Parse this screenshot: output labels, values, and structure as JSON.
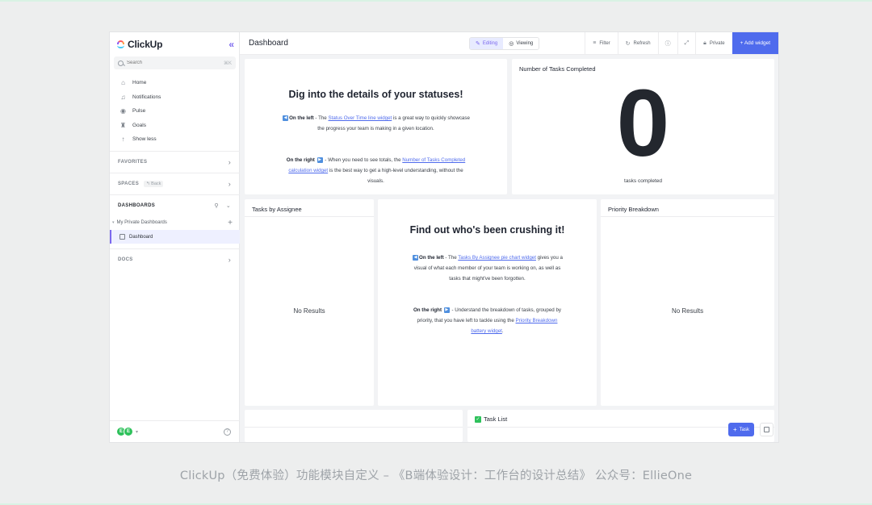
{
  "app": {
    "brand": "ClickUp",
    "search": {
      "placeholder": "Search",
      "shortcut": "⌘K"
    },
    "nav": [
      {
        "label": "Home",
        "icon": "home-icon"
      },
      {
        "label": "Notifications",
        "icon": "bell-icon"
      },
      {
        "label": "Pulse",
        "icon": "pulse-icon"
      },
      {
        "label": "Goals",
        "icon": "trophy-icon"
      },
      {
        "label": "Show less",
        "icon": "arrow-up-icon"
      }
    ],
    "sections": {
      "favorites": "FAVORITES",
      "spaces": "SPACES",
      "spaces_back": "Back",
      "dashboards": "DASHBOARDS",
      "docs": "DOCS"
    },
    "dashboards_group": "My Private Dashboards",
    "dashboard_item": "Dashboard",
    "avatars": [
      "E",
      "E"
    ]
  },
  "header": {
    "title": "Dashboard",
    "mode_editing": "Editing",
    "mode_viewing": "Viewing",
    "filter": "Filter",
    "refresh": "Refresh",
    "private": "Private",
    "add_widget": "+ Add widget"
  },
  "widgets": {
    "statuses": {
      "heading": "Dig into the details of your statuses!",
      "left_label": "On the left",
      "left_pre": " - The ",
      "left_link": "Status Over Time line widget",
      "left_post_1": " is a great way to quickly showcase",
      "left_post_2": "the progress your team is making in a given location.",
      "right_label": "On the right",
      "right_pre": " - When you need to see totals, the ",
      "right_link_1": "Number of Tasks Completed",
      "right_link_2": "calculation widget",
      "right_post_1": " is the best way to get a high-level understanding, without the",
      "right_post_2": "visuals."
    },
    "tasks_completed": {
      "title": "Number of Tasks Completed",
      "value": "0",
      "caption": "tasks completed"
    },
    "tasks_by_assignee": {
      "title": "Tasks by Assignee",
      "empty": "No Results"
    },
    "crushing": {
      "heading": "Find out who's been crushing it!",
      "left_label": "On the left",
      "left_pre": " - The ",
      "left_link": "Tasks By Assignee pie chart widget",
      "left_post_1": " gives you a",
      "left_post_2": "visual of what each member of your team is working on, as well as",
      "left_post_3": "tasks that might've been forgotten.",
      "right_label": "On the right",
      "right_pre_1": " - Understand the breakdown of tasks, grouped by",
      "right_pre_2": "priority, that you have left to tackle using the ",
      "right_link_1": "Priority Breakdown",
      "right_link_2": "battery widget",
      "right_post": "."
    },
    "priority_breakdown": {
      "title": "Priority Breakdown",
      "empty": "No Results"
    },
    "task_list": {
      "title": "Task List"
    }
  },
  "fab": {
    "task": "Task"
  },
  "caption": "ClickUp（免费体验）功能模块自定义 – 《B端体验设计：工作台的设计总结》 公众号：EllieOne",
  "colors": {
    "accent": "#4f6bed",
    "brand_purple": "#7b68ee",
    "avatar_green": "#2ec15b"
  }
}
